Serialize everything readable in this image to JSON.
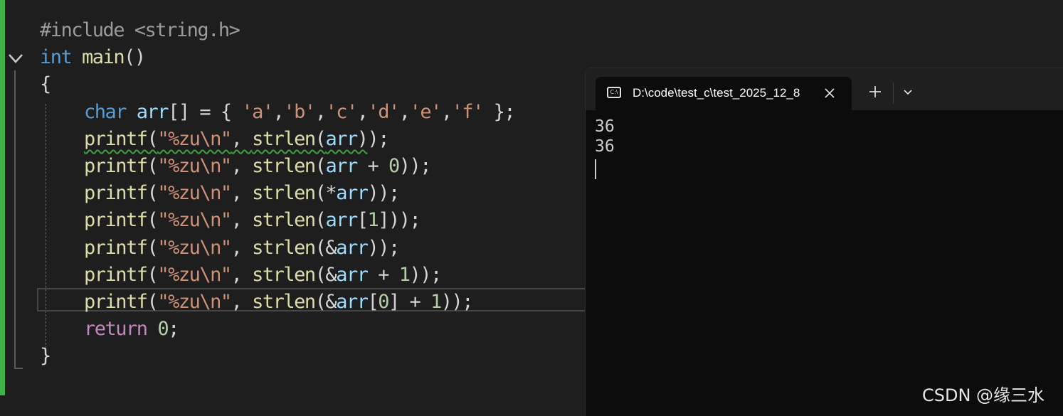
{
  "editor": {
    "lines": [
      [
        {
          "t": "#include <string.h>",
          "c": "pp"
        }
      ],
      [
        {
          "t": "int",
          "c": "kw"
        },
        {
          "t": " "
        },
        {
          "t": "main",
          "c": "fn"
        },
        {
          "t": "()",
          "c": "punc"
        }
      ],
      [
        {
          "t": "{",
          "c": "punc"
        }
      ],
      [
        {
          "indent": true
        },
        {
          "t": "char",
          "c": "kw"
        },
        {
          "t": " "
        },
        {
          "t": "arr",
          "c": "id"
        },
        {
          "t": "[] = { ",
          "c": "punc"
        },
        {
          "t": "'a'",
          "c": "str"
        },
        {
          "t": ",",
          "c": "punc"
        },
        {
          "t": "'b'",
          "c": "str"
        },
        {
          "t": ",",
          "c": "punc"
        },
        {
          "t": "'c'",
          "c": "str"
        },
        {
          "t": ",",
          "c": "punc"
        },
        {
          "t": "'d'",
          "c": "str"
        },
        {
          "t": ",",
          "c": "punc"
        },
        {
          "t": "'e'",
          "c": "str"
        },
        {
          "t": ",",
          "c": "punc"
        },
        {
          "t": "'f'",
          "c": "str"
        },
        {
          "t": " };",
          "c": "punc"
        }
      ],
      [
        {
          "indent": true
        },
        {
          "t": "printf",
          "c": "fn",
          "sq": true
        },
        {
          "t": "(",
          "c": "punc",
          "sq": true
        },
        {
          "t": "\"%zu\\n\"",
          "c": "str",
          "sq": true
        },
        {
          "t": ", ",
          "c": "punc",
          "sq": true
        },
        {
          "t": "strlen",
          "c": "fn",
          "sq": true
        },
        {
          "t": "(",
          "c": "punc",
          "sq": true
        },
        {
          "t": "arr",
          "c": "id",
          "sq": true
        },
        {
          "t": ")",
          "c": "punc",
          "sq": true
        },
        {
          "t": ");",
          "c": "punc"
        }
      ],
      [
        {
          "indent": true
        },
        {
          "t": "printf",
          "c": "fn"
        },
        {
          "t": "(",
          "c": "punc"
        },
        {
          "t": "\"%zu\\n\"",
          "c": "str"
        },
        {
          "t": ", ",
          "c": "punc"
        },
        {
          "t": "strlen",
          "c": "fn"
        },
        {
          "t": "(",
          "c": "punc"
        },
        {
          "t": "arr",
          "c": "id"
        },
        {
          "t": " + ",
          "c": "punc"
        },
        {
          "t": "0",
          "c": "num"
        },
        {
          "t": "));",
          "c": "punc"
        }
      ],
      [
        {
          "indent": true
        },
        {
          "t": "printf",
          "c": "fn"
        },
        {
          "t": "(",
          "c": "punc"
        },
        {
          "t": "\"%zu\\n\"",
          "c": "str"
        },
        {
          "t": ", ",
          "c": "punc"
        },
        {
          "t": "strlen",
          "c": "fn"
        },
        {
          "t": "(*",
          "c": "punc"
        },
        {
          "t": "arr",
          "c": "id"
        },
        {
          "t": "));",
          "c": "punc"
        }
      ],
      [
        {
          "indent": true
        },
        {
          "t": "printf",
          "c": "fn"
        },
        {
          "t": "(",
          "c": "punc"
        },
        {
          "t": "\"%zu\\n\"",
          "c": "str"
        },
        {
          "t": ", ",
          "c": "punc"
        },
        {
          "t": "strlen",
          "c": "fn"
        },
        {
          "t": "(",
          "c": "punc"
        },
        {
          "t": "arr",
          "c": "id"
        },
        {
          "t": "[",
          "c": "punc"
        },
        {
          "t": "1",
          "c": "num"
        },
        {
          "t": "]));",
          "c": "punc"
        }
      ],
      [
        {
          "indent": true
        },
        {
          "t": "printf",
          "c": "fn"
        },
        {
          "t": "(",
          "c": "punc"
        },
        {
          "t": "\"%zu\\n\"",
          "c": "str"
        },
        {
          "t": ", ",
          "c": "punc"
        },
        {
          "t": "strlen",
          "c": "fn"
        },
        {
          "t": "(&",
          "c": "punc"
        },
        {
          "t": "arr",
          "c": "id"
        },
        {
          "t": "));",
          "c": "punc"
        }
      ],
      [
        {
          "indent": true
        },
        {
          "t": "printf",
          "c": "fn"
        },
        {
          "t": "(",
          "c": "punc"
        },
        {
          "t": "\"%zu\\n\"",
          "c": "str"
        },
        {
          "t": ", ",
          "c": "punc"
        },
        {
          "t": "strlen",
          "c": "fn"
        },
        {
          "t": "(&",
          "c": "punc"
        },
        {
          "t": "arr",
          "c": "id"
        },
        {
          "t": " + ",
          "c": "punc"
        },
        {
          "t": "1",
          "c": "num"
        },
        {
          "t": "));",
          "c": "punc"
        }
      ],
      [
        {
          "indent": true
        },
        {
          "t": "printf",
          "c": "fn"
        },
        {
          "t": "(",
          "c": "punc"
        },
        {
          "t": "\"%zu\\n\"",
          "c": "str"
        },
        {
          "t": ", ",
          "c": "punc"
        },
        {
          "t": "strlen",
          "c": "fn"
        },
        {
          "t": "(&",
          "c": "punc"
        },
        {
          "t": "arr",
          "c": "id"
        },
        {
          "t": "[",
          "c": "punc"
        },
        {
          "t": "0",
          "c": "num"
        },
        {
          "t": "] + ",
          "c": "punc"
        },
        {
          "t": "1",
          "c": "num"
        },
        {
          "t": "));",
          "c": "punc"
        }
      ],
      [
        {
          "indent": true
        },
        {
          "t": "return",
          "c": "kw2"
        },
        {
          "t": " "
        },
        {
          "t": "0",
          "c": "num"
        },
        {
          "t": ";",
          "c": "punc"
        }
      ],
      [
        {
          "t": "}",
          "c": "punc"
        }
      ]
    ]
  },
  "terminal": {
    "tab_title": "D:\\code\\test_c\\test_2025_12_8",
    "tab_icon_glyph": "C:\\",
    "output_lines": [
      "36",
      "36"
    ]
  },
  "watermark": "CSDN @缘三水",
  "colors": {
    "gutter_bar": "#3fb24a",
    "squiggle": "#3ea03e",
    "keyword": "#569cd6",
    "function": "#dcdcaa",
    "string": "#ce9178",
    "identifier": "#9cdcfe",
    "number": "#b5cea8"
  },
  "icons": [
    "chevron-down-icon",
    "terminal-icon",
    "close-icon",
    "plus-icon",
    "chevron-down-icon"
  ]
}
